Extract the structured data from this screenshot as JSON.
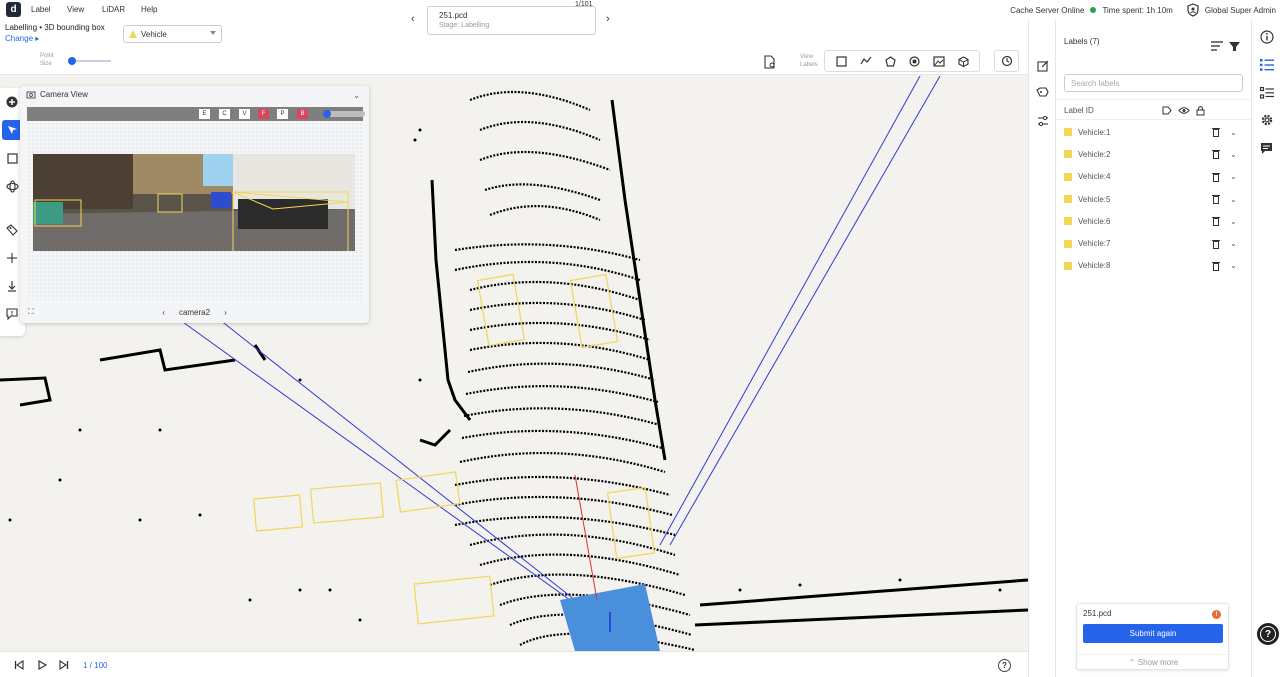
{
  "menu": {
    "logo": "d",
    "items": [
      "Label",
      "View",
      "LiDAR",
      "Help"
    ]
  },
  "status": {
    "cache_server": "Cache Server Online",
    "time_spent": "Time spent: 1h 10m",
    "user": "Global Super Admin"
  },
  "task": {
    "breadcrumb": "Labelling • 3D bounding box",
    "change": "Change",
    "change_arrow": "▸"
  },
  "class_selector": {
    "value": "Vehicle"
  },
  "file": {
    "name": "251.pcd",
    "stage": "Stage: Labelling",
    "counter": "1/101",
    "prev": "‹",
    "next": "›"
  },
  "point_size": {
    "label_1": "Point",
    "label_2": "Size",
    "value": 0.1
  },
  "view_labels": {
    "label_1": "View",
    "label_2": "Labels"
  },
  "camera_view": {
    "title": "Camera View",
    "toggles": [
      "E",
      "C",
      "V",
      "F",
      "P",
      "B"
    ],
    "camera_name": "camera2",
    "prev": "‹",
    "next": "›"
  },
  "frames": {
    "indicator": "1 / 100"
  },
  "labels_panel": {
    "title": "Labels (7)",
    "search_placeholder": "Search labels",
    "column_header": "Label ID",
    "items": [
      {
        "name": "Vehicle:1",
        "color": "#f2d654"
      },
      {
        "name": "Vehicle:2",
        "color": "#f2d654"
      },
      {
        "name": "Vehicle:4",
        "color": "#f2d654"
      },
      {
        "name": "Vehicle:5",
        "color": "#f2d654"
      },
      {
        "name": "Vehicle:6",
        "color": "#f2d654"
      },
      {
        "name": "Vehicle:7",
        "color": "#f2d654"
      },
      {
        "name": "Vehicle:8",
        "color": "#f2d654"
      }
    ]
  },
  "submit_card": {
    "file": "251.pcd",
    "button": "Submit again",
    "show_more": "Show more",
    "alert": "!"
  },
  "colors": {
    "accent": "#2563eb",
    "label_yellow": "#f2d654",
    "online_green": "#22a447",
    "ego_vehicle": "#4a8fdc"
  }
}
